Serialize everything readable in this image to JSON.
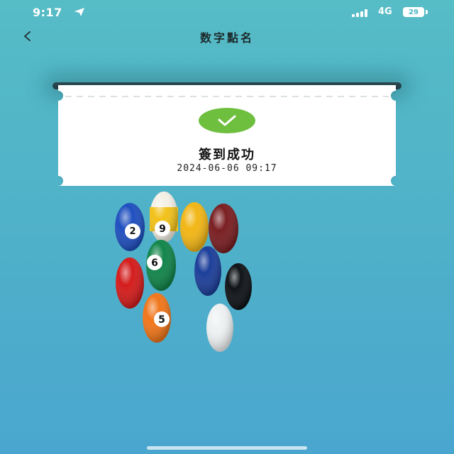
{
  "status_bar": {
    "time": "9:17",
    "network": "4G",
    "battery": "29"
  },
  "nav": {
    "back_label": "<",
    "title": "数字點名"
  },
  "result": {
    "title": "簽到成功",
    "timestamp": "2024-06-06 09:17"
  },
  "colors": {
    "background": "#52b4c8",
    "success_green": "#6fbf3f",
    "ticket": "#ffffff"
  },
  "icons": {
    "location": "location-arrow-icon",
    "signal": "signal-bars-icon",
    "battery": "battery-icon",
    "check": "checkmark-icon"
  },
  "balls": [
    "2",
    "9",
    "",
    "",
    "6",
    "",
    "",
    "",
    "5",
    ""
  ]
}
